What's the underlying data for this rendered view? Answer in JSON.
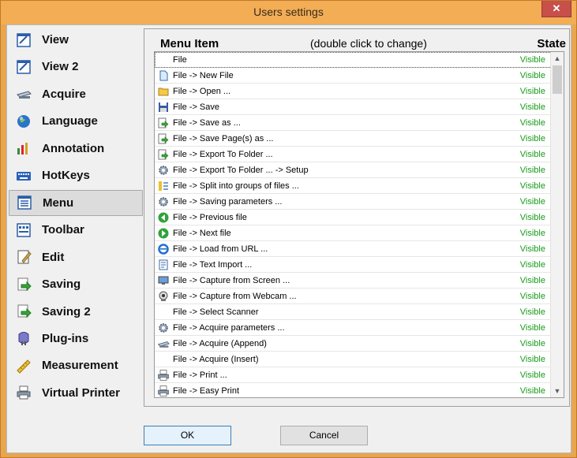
{
  "window": {
    "title": "Users settings",
    "close_glyph": "✕"
  },
  "nav": {
    "items": [
      {
        "label": "View",
        "icon": "view-icon"
      },
      {
        "label": "View 2",
        "icon": "view2-icon"
      },
      {
        "label": "Acquire",
        "icon": "scanner-icon"
      },
      {
        "label": "Language",
        "icon": "globe-icon"
      },
      {
        "label": "Annotation",
        "icon": "annotation-icon"
      },
      {
        "label": "HotKeys",
        "icon": "keyboard-icon"
      },
      {
        "label": "Menu",
        "icon": "menu-icon",
        "active": true
      },
      {
        "label": "Toolbar",
        "icon": "toolbar-icon"
      },
      {
        "label": "Edit",
        "icon": "edit-icon"
      },
      {
        "label": "Saving",
        "icon": "saving-icon"
      },
      {
        "label": "Saving 2",
        "icon": "saving2-icon"
      },
      {
        "label": "Plug-ins",
        "icon": "plugin-icon"
      },
      {
        "label": "Measurement",
        "icon": "ruler-icon"
      },
      {
        "label": "Virtual Printer",
        "icon": "printer-icon"
      }
    ]
  },
  "panel": {
    "header_item": "Menu Item",
    "header_hint": "(double click to change)",
    "header_state": "State",
    "rows": [
      {
        "label": "File",
        "state": "Visible",
        "icon": "none"
      },
      {
        "label": "File -> New File",
        "state": "Visible",
        "icon": "new-file-icon"
      },
      {
        "label": "File -> Open ...",
        "state": "Visible",
        "icon": "folder-icon"
      },
      {
        "label": "File -> Save",
        "state": "Visible",
        "icon": "floppy-icon"
      },
      {
        "label": "File -> Save as ...",
        "state": "Visible",
        "icon": "save-as-icon"
      },
      {
        "label": "File -> Save Page(s) as ...",
        "state": "Visible",
        "icon": "save-as-icon"
      },
      {
        "label": "File -> Export To Folder ...",
        "state": "Visible",
        "icon": "save-as-icon"
      },
      {
        "label": "File -> Export To Folder ... -> Setup",
        "state": "Visible",
        "icon": "gear-icon"
      },
      {
        "label": "File -> Split into groups of files ...",
        "state": "Visible",
        "icon": "split-icon"
      },
      {
        "label": "File -> Saving parameters ...",
        "state": "Visible",
        "icon": "gear-icon"
      },
      {
        "label": "File -> Previous file",
        "state": "Visible",
        "icon": "arrow-left-icon"
      },
      {
        "label": "File -> Next file",
        "state": "Visible",
        "icon": "arrow-right-icon"
      },
      {
        "label": "File -> Load from URL ...",
        "state": "Visible",
        "icon": "ie-icon"
      },
      {
        "label": "File -> Text Import ...",
        "state": "Visible",
        "icon": "text-import-icon"
      },
      {
        "label": "File -> Capture from Screen ...",
        "state": "Visible",
        "icon": "monitor-icon"
      },
      {
        "label": "File -> Capture from Webcam ...",
        "state": "Visible",
        "icon": "webcam-icon"
      },
      {
        "label": "File -> Select Scanner",
        "state": "Visible",
        "icon": "none"
      },
      {
        "label": "File -> Acquire parameters ...",
        "state": "Visible",
        "icon": "gear-icon"
      },
      {
        "label": "File -> Acquire (Append)",
        "state": "Visible",
        "icon": "scanner-icon"
      },
      {
        "label": "File -> Acquire (Insert)",
        "state": "Visible",
        "icon": "none"
      },
      {
        "label": "File -> Print ...",
        "state": "Visible",
        "icon": "printer-icon"
      },
      {
        "label": "File -> Easy Print",
        "state": "Visible",
        "icon": "printer-icon"
      }
    ]
  },
  "scroll": {
    "up": "▲",
    "down": "▼"
  },
  "footer": {
    "ok_label": "OK",
    "cancel_label": "Cancel"
  }
}
